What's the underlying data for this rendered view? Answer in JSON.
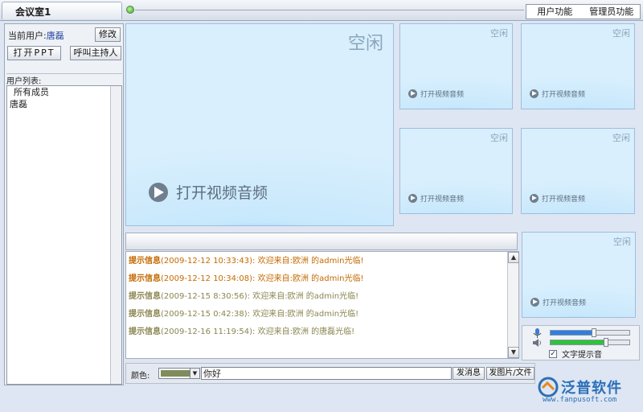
{
  "window": {
    "room_tab": "会议室1",
    "menu": [
      "用户功能",
      "管理员功能"
    ]
  },
  "left_panel": {
    "current_user_label": "当前用户:",
    "current_user_name": "唐磊",
    "edit_button": "修改",
    "ppt_button": "打开PPT",
    "host_button": "呼叫主持人",
    "userlist_header": "用户列表:",
    "users": [
      "所有成员",
      "唐磊"
    ]
  },
  "video": {
    "main": {
      "status": "空闲",
      "action": "打开视频音频"
    },
    "tiles": [
      {
        "status": "空闲",
        "action": "打开视频音频"
      },
      {
        "status": "空闲",
        "action": "打开视频音频"
      },
      {
        "status": "空闲",
        "action": "打开视频音频"
      },
      {
        "status": "空闲",
        "action": "打开视频音频"
      },
      {
        "status": "空闲",
        "action": "打开视频音频"
      }
    ]
  },
  "log": {
    "messages": [
      {
        "tag": "提示信息",
        "time": "(2009-12-12 10:33:43):",
        "text": "欢迎来自:欧洲 的admin光临!",
        "color": "#c46a00"
      },
      {
        "tag": "提示信息",
        "time": "(2009-12-12 10:34:08):",
        "text": "欢迎来自:欧洲 的admin光临!",
        "color": "#c46a00"
      },
      {
        "tag": "提示信息",
        "time": "(2009-12-15 8:30:56):",
        "text": "欢迎来自:欧洲 的admin光临!",
        "color": "#8a8650"
      },
      {
        "tag": "提示信息",
        "time": "(2009-12-15 0:42:38):",
        "text": "欢迎来自:欧洲 的admin光临!",
        "color": "#8a8650"
      },
      {
        "tag": "提示信息",
        "time": "(2009-12-16 11:19:54):",
        "text": "欢迎来自:欧洲 的唐磊光临!",
        "color": "#8a8650"
      }
    ]
  },
  "input": {
    "color_label": "颜色:",
    "color_value": "#808c5a",
    "message": "你好",
    "send_button": "发消息",
    "send_image_button": "发图片/文件"
  },
  "audio": {
    "mic_level": 0.55,
    "speaker_level": 0.7,
    "mic_color": "#2f7fe0",
    "speaker_color": "#2ec33a",
    "text_hint_label": "文字提示音",
    "text_hint_checked": true
  },
  "logo": {
    "brand": "泛普软件",
    "site": "www.fanpusoft.com"
  }
}
